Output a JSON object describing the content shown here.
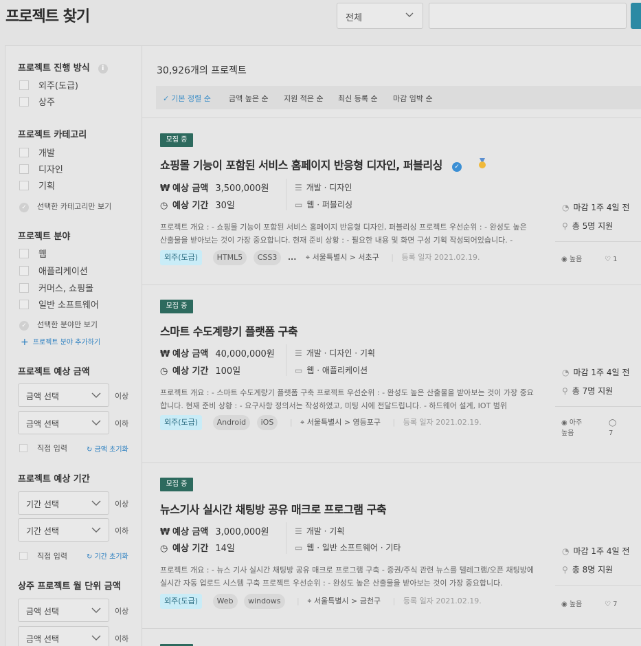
{
  "page_title": "프로젝트 찾기",
  "search": {
    "category": "전체",
    "placeholder": ""
  },
  "sidebar": {
    "method": {
      "title": "프로젝트 진행 방식",
      "info": "i",
      "options": [
        "외주(도급)",
        "상주"
      ]
    },
    "category": {
      "title": "프로젝트 카테고리",
      "options": [
        "개발",
        "디자인",
        "기획"
      ],
      "only_selected": "선택한 카테고리만 보기"
    },
    "field": {
      "title": "프로젝트 분야",
      "options": [
        "웹",
        "애플리케이션",
        "커머스, 쇼핑몰",
        "일반 소프트웨어"
      ],
      "only_selected": "선택한 분야만 보기",
      "add": "프로젝트 분야 추가하기"
    },
    "budget": {
      "title": "프로젝트 예상 금액",
      "min_placeholder": "금액 선택",
      "max_placeholder": "금액 선택",
      "min_suffix": "이상",
      "max_suffix": "이하",
      "direct": "직접 입력",
      "reset": "금액 초기화"
    },
    "period": {
      "title": "프로젝트 예상 기간",
      "min_placeholder": "기간 선택",
      "max_placeholder": "기간 선택",
      "min_suffix": "이상",
      "max_suffix": "이하",
      "direct": "직접 입력",
      "reset": "기간 초기화"
    },
    "monthly": {
      "title": "상주 프로젝트 월 단위 금액",
      "min_placeholder": "금액 선택",
      "max_placeholder": "금액 선택",
      "min_suffix": "이상",
      "max_suffix": "이하"
    }
  },
  "main": {
    "count": "30,926개의 프로젝트",
    "sorts": [
      "기본 정렬 순",
      "금액 높은 순",
      "지원 적은 순",
      "최신 등록 순",
      "마감 임박 순"
    ],
    "projects": [
      {
        "status": "모집 중",
        "title": "쇼핑몰 기능이 포함된 서비스 홈페이지 반응형 디자인, 퍼블리싱",
        "budget_label": "예상 금액",
        "budget": "3,500,000원",
        "period_label": "예상 기간",
        "period": "30일",
        "category": "개발 · 디자인",
        "field": "웹 · 퍼블리싱",
        "desc": "프로젝트 개요 : - 쇼핑몰 기능이 포함된 서비스 홈페이지 반응형 디자인, 퍼블리싱 프로젝트 우선순위 : - 완성도 높은 산출물을 받아보는 것이 가장 중요합니다. 현재 준비 상황 : - 필요한 내용 및 화면 구성 기획 작성되어있습니다. -",
        "type": "외주(도급)",
        "tags": [
          "HTML5",
          "CSS3"
        ],
        "more": "...",
        "location": "서울특별시 > 서초구",
        "date": "등록 일자 2021.02.19.",
        "deadline": "마감 1주 4일 전",
        "applicants": "총 5명 지원",
        "stat1": "높음",
        "stat2": "1"
      },
      {
        "status": "모집 중",
        "title": "스마트 수도계량기 플랫폼 구축",
        "budget_label": "예상 금액",
        "budget": "40,000,000원",
        "period_label": "예상 기간",
        "period": "100일",
        "category": "개발 · 디자인 · 기획",
        "field": "웹 · 애플리케이션",
        "desc": "프로젝트 개요 : - 스마트 수도계량기 플랫폼 구축 프로젝트 우선순위 : - 완성도 높은 산출물을 받아보는 것이 가장 중요합니다. 현재 준비 상황 : - 요구사항 정의서는 작성하였고, 미팅 시에 전달드립니다. - 하드웨어 설계, IOT 범위",
        "type": "외주(도급)",
        "tags": [
          "Android",
          "iOS"
        ],
        "more": "",
        "location": "서울특별시 > 영등포구",
        "date": "등록 일자 2021.02.19.",
        "deadline": "마감 1주 4일 전",
        "applicants": "총 7명 지원",
        "stat1": "아주\n높음",
        "stat2": "7"
      },
      {
        "status": "모집 중",
        "title": "뉴스기사 실시간 채팅방 공유 매크로 프로그램 구축",
        "budget_label": "예상 금액",
        "budget": "3,000,000원",
        "period_label": "예상 기간",
        "period": "14일",
        "category": "개발 · 기획",
        "field": "웹 · 일반 소프트웨어 · 기타",
        "desc": "프로젝트 개요 : - 뉴스 기사 실시간 채팅방 공유 매크로 프로그램 구축 - 증권/주식 관련 뉴스를 텔레그램/오픈 채팅방에 실시간 자동 업로드 시스템 구축 프로젝트 우선순위 : - 완성도 높은 산출물을 받아보는 것이 가장 중요합니다.",
        "type": "외주(도급)",
        "tags": [
          "Web",
          "windows"
        ],
        "more": "",
        "location": "서울특별시 > 금천구",
        "date": "등록 일자 2021.02.19.",
        "deadline": "마감 1주 4일 전",
        "applicants": "총 8명 지원",
        "stat1": "높음",
        "stat2": "7"
      }
    ]
  },
  "colors": {
    "accent": "#2c8aa4",
    "badge": "#2d6a5e",
    "link": "#2b7fc0",
    "type_tag": "#c9ecf7"
  }
}
